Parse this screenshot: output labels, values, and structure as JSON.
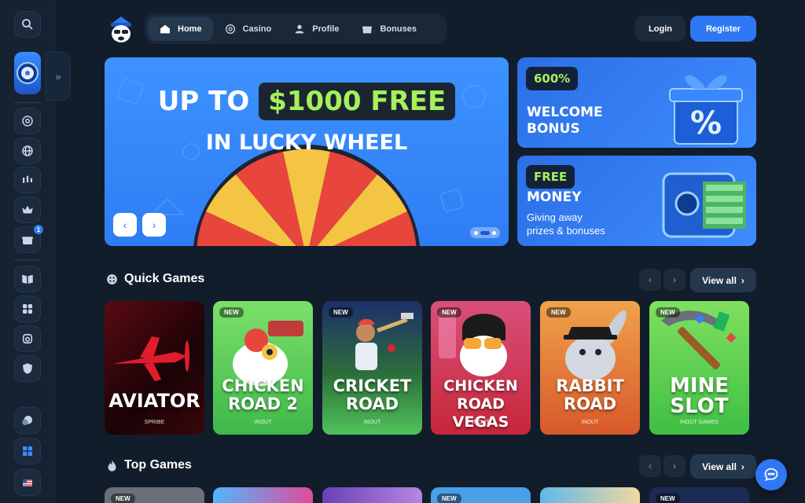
{
  "nav": {
    "items": [
      {
        "label": "Home",
        "icon": "home-icon"
      },
      {
        "label": "Casino",
        "icon": "casino-chip-icon"
      },
      {
        "label": "Profile",
        "icon": "user-icon"
      },
      {
        "label": "Bonuses",
        "icon": "gift-icon"
      }
    ],
    "active": "Home"
  },
  "auth": {
    "login": "Login",
    "register": "Register"
  },
  "hero": {
    "prefix": "UP TO",
    "highlight": "$1000 FREE",
    "subtitle": "IN LUCKY WHEEL",
    "prev": "‹",
    "next": "›"
  },
  "promos": [
    {
      "tag": "600%",
      "title1": "WELCOME",
      "title2": "BONUS"
    },
    {
      "tag": "FREE",
      "title1": "MONEY",
      "desc1": "Giving away",
      "desc2": "prizes & bonuses"
    }
  ],
  "quick_games": {
    "title": "Quick Games",
    "view_all": "View all",
    "games": [
      {
        "name1": "AVIATOR",
        "name2": "",
        "provider": "SPRIBE",
        "is_new": false,
        "badge": ""
      },
      {
        "name1": "CHICKEN",
        "name2": "ROAD 2",
        "provider": "INOUT",
        "is_new": true,
        "badge": "NEW"
      },
      {
        "name1": "CRICKET",
        "name2": "ROAD",
        "provider": "INOUT",
        "is_new": true,
        "badge": "NEW"
      },
      {
        "name1": "CHICKEN",
        "name2": "ROAD VEGAS",
        "provider": "INOUT",
        "is_new": true,
        "badge": "NEW"
      },
      {
        "name1": "RABBIT",
        "name2": "ROAD",
        "provider": "INOUT",
        "is_new": true,
        "badge": "NEW"
      },
      {
        "name1": "MINE",
        "name2": "SLOT",
        "provider": "INOUT GAMES",
        "is_new": true,
        "badge": "NEW"
      }
    ]
  },
  "top_games": {
    "title": "Top Games",
    "view_all": "View all",
    "badges": [
      "NEW",
      "",
      "",
      "NEW",
      "",
      "NEW"
    ]
  },
  "colors": {
    "background": "#121d2b",
    "accent": "#2e78f3",
    "highlight_green": "#a6f05a"
  }
}
